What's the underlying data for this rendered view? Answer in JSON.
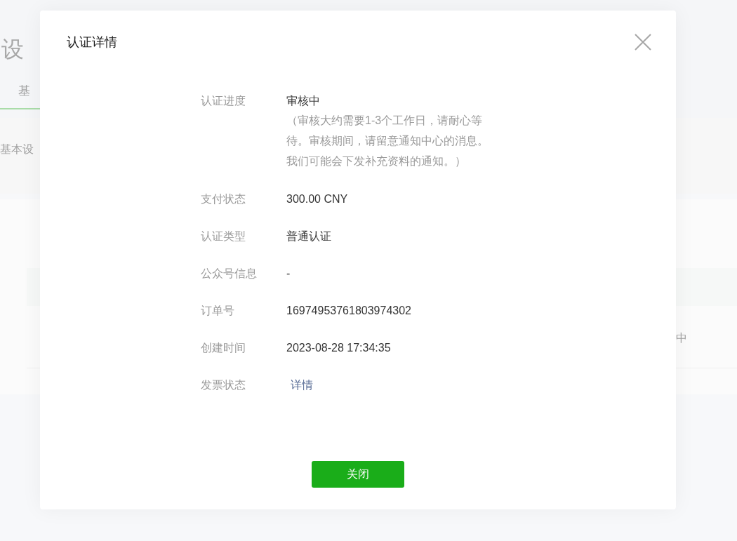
{
  "background": {
    "page_title": "设",
    "tab": "基",
    "section_label": "基本设",
    "status_text": "中"
  },
  "dialog": {
    "title": "认证详情",
    "rows": [
      {
        "label": "认证进度",
        "kind": "text",
        "value": "审核中",
        "note": "（审核大约需要1-3个工作日，请耐心等待。审核期间，请留意通知中心的消息。我们可能会下发补充资料的通知。）"
      },
      {
        "label": "支付状态",
        "kind": "text",
        "value": "300.00 CNY"
      },
      {
        "label": "认证类型",
        "kind": "text",
        "value": "普通认证"
      },
      {
        "label": "公众号信息",
        "kind": "text",
        "value": "-"
      },
      {
        "label": "订单号",
        "kind": "text",
        "value": "16974953761803974302"
      },
      {
        "label": "创建时间",
        "kind": "text",
        "value": "2023-08-28 17:34:35"
      },
      {
        "label": "发票状态",
        "kind": "link",
        "value": "详情"
      }
    ],
    "button": "关闭"
  }
}
